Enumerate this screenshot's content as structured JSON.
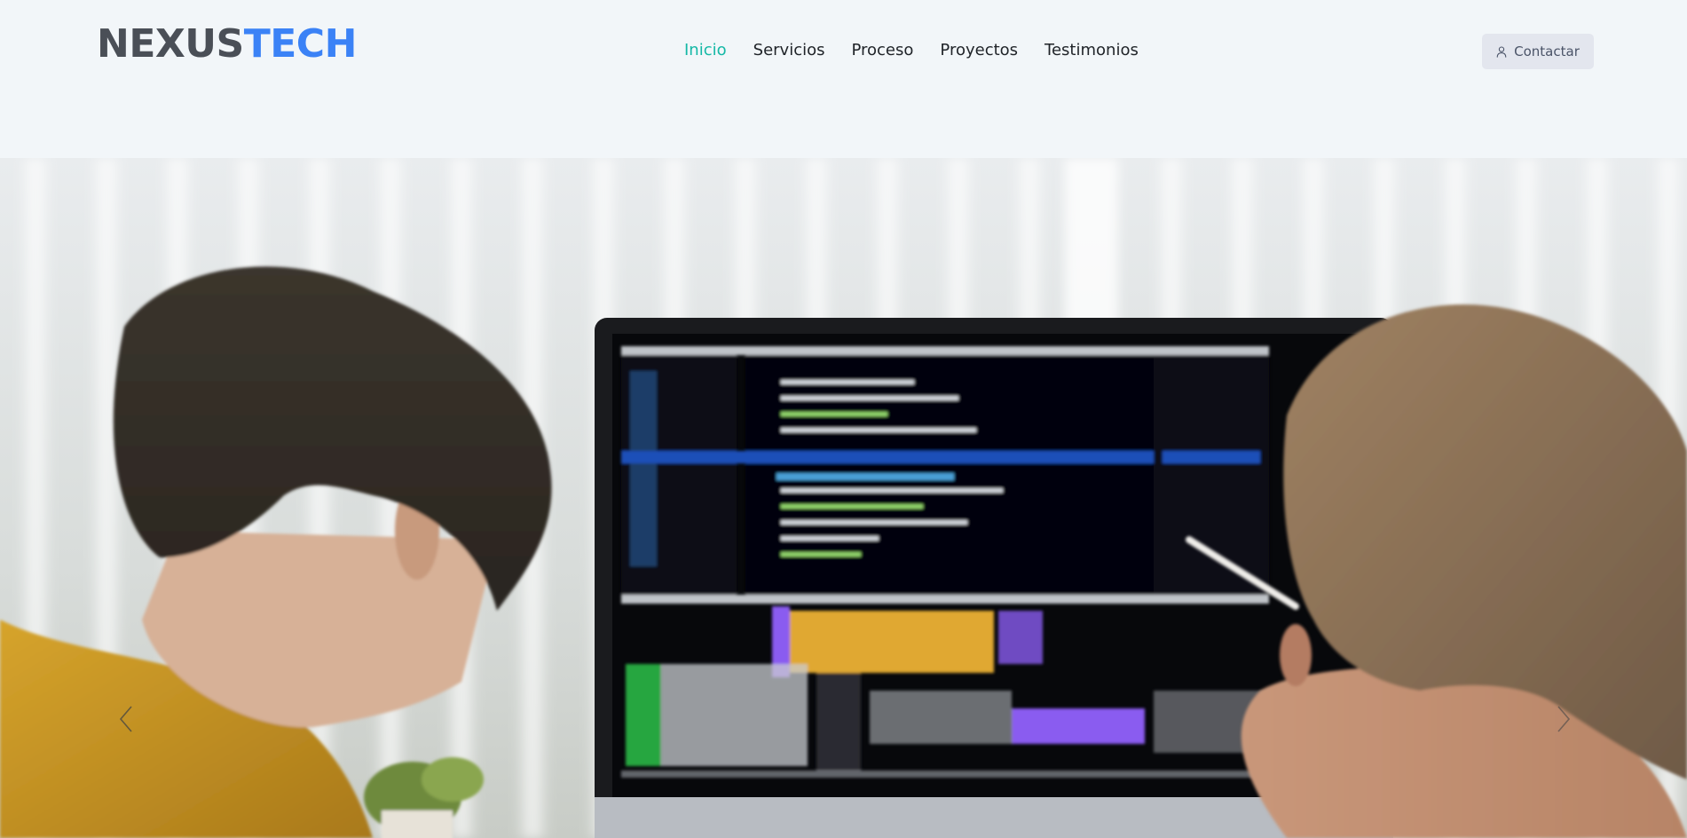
{
  "brand": {
    "part1": "NEXUS",
    "part2": "TECH",
    "color_dark": "#4a4f57",
    "color_accent": "#3b82f6"
  },
  "nav": {
    "items": [
      {
        "label": "Inicio",
        "active": true
      },
      {
        "label": "Servicios",
        "active": false
      },
      {
        "label": "Proceso",
        "active": false
      },
      {
        "label": "Proyectos",
        "active": false
      },
      {
        "label": "Testimonios",
        "active": false
      }
    ],
    "active_color": "#14b8a6"
  },
  "contact_button": {
    "label": "Contactar",
    "icon": "user-icon"
  },
  "hero": {
    "image": "two-developers-looking-at-code-on-monitor",
    "prev_icon": "chevron-left-icon",
    "next_icon": "chevron-right-icon"
  }
}
